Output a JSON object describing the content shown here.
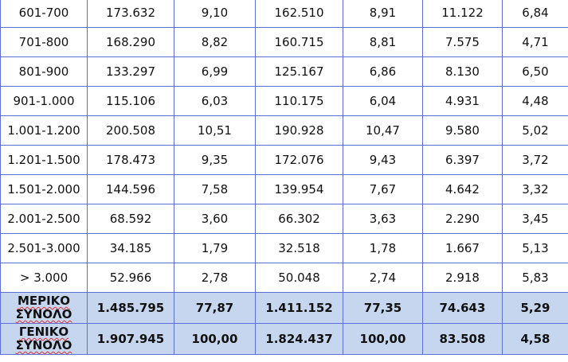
{
  "table": {
    "rows": [
      [
        "601-700",
        "173.632",
        "9,10",
        "162.510",
        "8,91",
        "11.122",
        "6,84"
      ],
      [
        "701-800",
        "168.290",
        "8,82",
        "160.715",
        "8,81",
        "7.575",
        "4,71"
      ],
      [
        "801-900",
        "133.297",
        "6,99",
        "125.167",
        "6,86",
        "8.130",
        "6,50"
      ],
      [
        "901-1.000",
        "115.106",
        "6,03",
        "110.175",
        "6,04",
        "4.931",
        "4,48"
      ],
      [
        "1.001-1.200",
        "200.508",
        "10,51",
        "190.928",
        "10,47",
        "9.580",
        "5,02"
      ],
      [
        "1.201-1.500",
        "178.473",
        "9,35",
        "172.076",
        "9,43",
        "6.397",
        "3,72"
      ],
      [
        "1.501-2.000",
        "144.596",
        "7,58",
        "139.954",
        "7,67",
        "4.642",
        "3,32"
      ],
      [
        "2.001-2.500",
        "68.592",
        "3,60",
        "66.302",
        "3,63",
        "2.290",
        "3,45"
      ],
      [
        "2.501-3.000",
        "34.185",
        "1,79",
        "32.518",
        "1,78",
        "1.667",
        "5,13"
      ],
      [
        "> 3.000",
        "52.966",
        "2,78",
        "50.048",
        "2,74",
        "2.918",
        "5,83"
      ]
    ],
    "totals": [
      {
        "label_lines": [
          "ΜΕΡΙΚΟ",
          "ΣΥΝΟΛΟ"
        ],
        "values": [
          "1.485.795",
          "77,87",
          "1.411.152",
          "77,35",
          "74.643",
          "5,29"
        ]
      },
      {
        "label_lines": [
          "ΓΕΝΙΚΟ",
          "ΣΥΝΟΛΟ"
        ],
        "values": [
          "1.907.945",
          "100,00",
          "1.824.437",
          "100,00",
          "83.508",
          "4,58"
        ]
      }
    ],
    "colors": {
      "border": "#5b6fd6",
      "total_row_fill": "#c6d6ee",
      "spellcheck_underline": "#e23232"
    }
  }
}
